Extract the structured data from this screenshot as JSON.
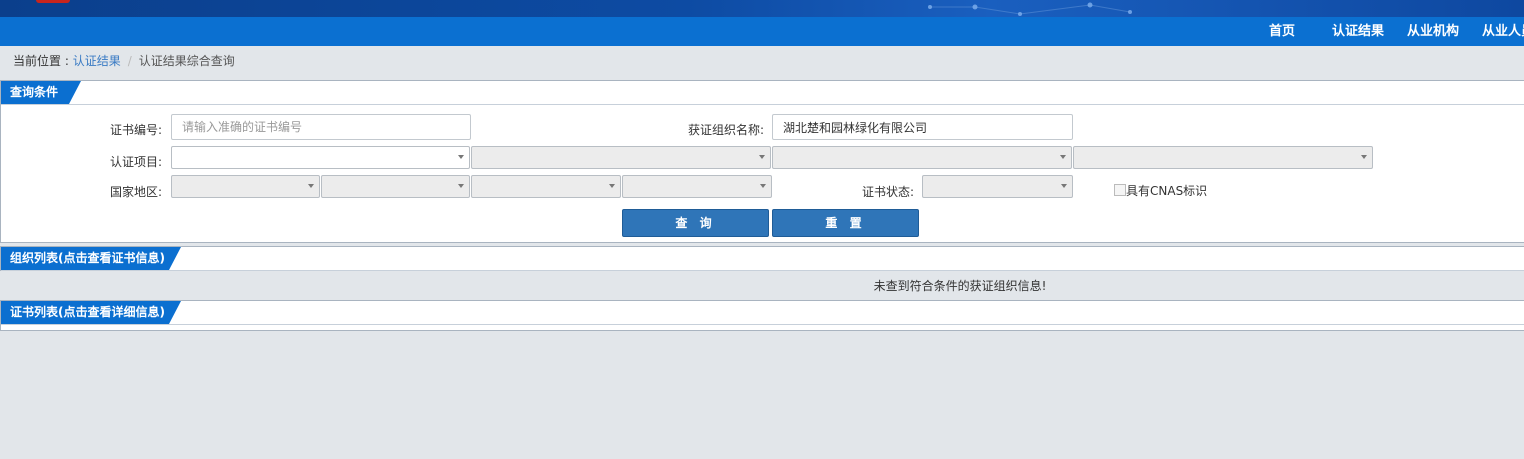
{
  "nav": {
    "items": [
      "首页",
      "认证结果",
      "从业机构",
      "从业人员"
    ]
  },
  "breadcrumb": {
    "prefix": "当前位置 : ",
    "link": "认证结果",
    "separator": "/",
    "current": "认证结果综合查询"
  },
  "query_panel": {
    "title": "查询条件",
    "cert_no_label": "证书编号:",
    "cert_no_placeholder": "请输入准确的证书编号",
    "cert_no_value": "",
    "org_name_label": "获证组织名称:",
    "org_name_value": "湖北楚和园林绿化有限公司",
    "cert_project_label": "认证项目:",
    "region_label": "国家地区:",
    "cert_status_label": "证书状态:",
    "cnas_label": "具有CNAS标识",
    "search_button": "查 询",
    "reset_button": "重 置"
  },
  "org_panel": {
    "title": "组织列表(点击查看证书信息)",
    "empty_message": "未查到符合条件的获证组织信息!"
  },
  "cert_panel": {
    "title": "证书列表(点击查看详细信息)"
  },
  "colors": {
    "nav_bg": "#0b70d1",
    "accent": "#0b6fd0",
    "button_bg": "#2f75b8",
    "page_bg": "#e2e6ea"
  }
}
